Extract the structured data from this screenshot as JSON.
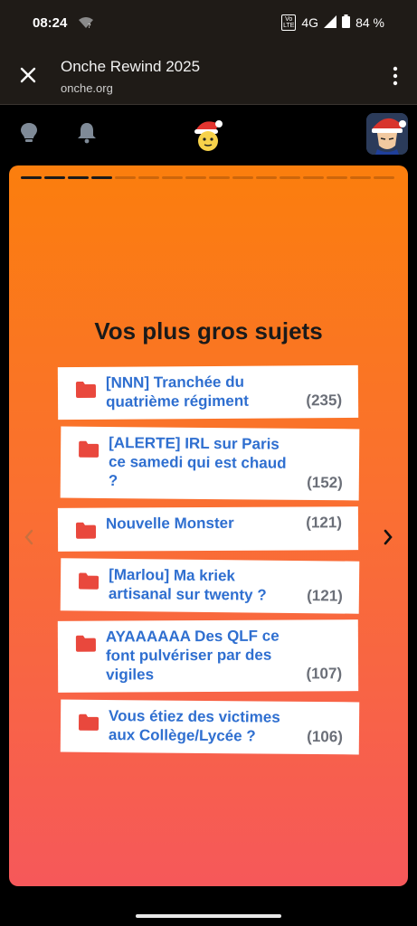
{
  "status": {
    "time": "08:24",
    "volte_top": "Vo",
    "volte_bottom": "LTE",
    "network": "4G",
    "battery": "84 %"
  },
  "browser": {
    "title": "Onche Rewind 2025",
    "domain": "onche.org",
    "close_icon": "close-icon",
    "menu_icon": "more-vert-icon"
  },
  "app": {
    "icons": [
      "lightbulb-icon",
      "bell-icon",
      "onche-logo-icon",
      "avatar"
    ]
  },
  "story": {
    "segments_total": 16,
    "segments_done": 4,
    "heading": "Vos plus gros sujets",
    "topics": [
      {
        "lines": [
          "[NNN] Tranchée du",
          "quatrième régiment"
        ],
        "count": "(235)"
      },
      {
        "lines": [
          "[ALERTE] IRL sur Paris",
          "ce samedi qui est chaud",
          "?"
        ],
        "count": "(152)"
      },
      {
        "lines": [
          "Nouvelle Monster"
        ],
        "count": "(121)"
      },
      {
        "lines": [
          "[Marlou] Ma kriek",
          "artisanal sur twenty ?"
        ],
        "count": "(121)"
      },
      {
        "lines": [
          "AYAAAAAA Des QLF ce",
          "font pulvériser par des",
          "vigiles"
        ],
        "count": "(107)"
      },
      {
        "lines": [
          "Vous étiez des victimes",
          "aux Collège/Lycée ?"
        ],
        "count": "(106)"
      }
    ]
  },
  "colors": {
    "card_top": "#fb7e0d",
    "card_bottom": "#f6585a",
    "topic_text": "#2f6fd0",
    "folder": "#e9483d",
    "count": "#6b6f78"
  }
}
